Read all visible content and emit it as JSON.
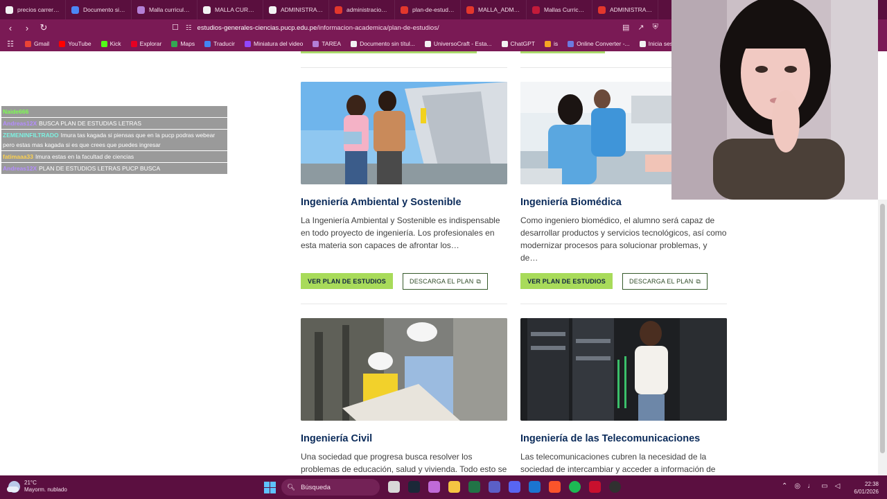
{
  "browser": {
    "tabs": [
      {
        "label": "precios carreras u",
        "color": "#f2f2f2"
      },
      {
        "label": "Documento sin tít",
        "color": "#4b86f5"
      },
      {
        "label": "Malla curricular E",
        "color": "#b37fd6"
      },
      {
        "label": "MALLA CURRICU",
        "color": "#f2f2f2"
      },
      {
        "label": "ADMINISTRACIÓ",
        "color": "#f2f2f2"
      },
      {
        "label": "administracion-d",
        "color": "#e3372c"
      },
      {
        "label": "plan-de-estudios",
        "color": "#e3372c"
      },
      {
        "label": "MALLA_ADMINI",
        "color": "#e3372c"
      },
      {
        "label": "Mallas Curricular",
        "color": "#c31b3a"
      },
      {
        "label": "ADMINISTRACIÓ",
        "color": "#e3372c"
      }
    ],
    "url_host": "estudios-generales-ciencias.pucp.edu.pe",
    "url_path": "/informacion-academica/plan-de-estudios/",
    "bookmarks": [
      {
        "label": "Gmail",
        "color": "#ea4335"
      },
      {
        "label": "YouTube",
        "color": "#ff0000"
      },
      {
        "label": "Kick",
        "color": "#53fc18"
      },
      {
        "label": "Explorar",
        "color": "#e60023"
      },
      {
        "label": "Maps",
        "color": "#34a853"
      },
      {
        "label": "Traducir",
        "color": "#4285f4"
      },
      {
        "label": "Miniatura del video",
        "color": "#9146ff"
      },
      {
        "label": "TAREA",
        "color": "#b37fd6"
      },
      {
        "label": "Documento sin títul...",
        "color": "#f2f2f2"
      },
      {
        "label": "UniversoCraft - Esta...",
        "color": "#f2f2f2"
      },
      {
        "label": "ChatGPT",
        "color": "#f2f2f2"
      },
      {
        "label": "is",
        "color": "#f5a623"
      },
      {
        "label": "Online Converter -...",
        "color": "#6c7ae0"
      },
      {
        "label": "Inicia sesión: Cuen",
        "color": "#f2f2f2"
      }
    ]
  },
  "cards": [
    {
      "title": "Ingeniería Ambiental y Sostenible",
      "description": "La Ingeniería Ambiental y Sostenible es indispensable en todo proyecto de ingeniería. Los profesionales en esta materia son capaces de afrontar los…",
      "plan_label": "VER PLAN DE ESTUDIOS",
      "download_label": "DESCARGA EL PLAN"
    },
    {
      "title": "Ingeniería Biomédica",
      "description": "Como ingeniero biomédico, el alumno será capaz de desarrollar productos y servicios tecnológicos, así como modernizar procesos para solucionar problemas, y de…",
      "plan_label": "VER PLAN DE ESTUDIOS",
      "download_label": "DESCARGA EL PLAN"
    },
    {
      "title": "Ingeniería Civil",
      "description": "Una sociedad que progresa busca resolver los problemas de educación, salud y vivienda. Todo esto se"
    },
    {
      "title": "Ingeniería de las Telecomunicaciones",
      "description": "Las telecomunicaciones cubren la necesidad de la sociedad de intercambiar y acceder a información de"
    }
  ],
  "chat": [
    {
      "user": "Naide666",
      "user_color": "#7cff4f",
      "message": ""
    },
    {
      "user": "Andreas12X",
      "user_color": "#b48cff",
      "message": "BUSCA PLAN DE ESTUDIAS LETRAS"
    },
    {
      "user": "ZEMENINFILTRADO",
      "user_color": "#7ef0e0",
      "message": "Imura tas kagada si piensas que en la pucp podras webear pero estas mas kagada si es que crees que puedes ingresar"
    },
    {
      "user": "fatimaaa33",
      "user_color": "#ffd34f",
      "message": "Imura estas en la facultad de ciencias"
    },
    {
      "user": "Andreas12X",
      "user_color": "#b48cff",
      "message": "PLAN DE ESTUDIOS LETRAS PUCP BUSCA"
    }
  ],
  "taskbar": {
    "temperature": "21°C",
    "condition": "Mayorm. nublado",
    "search_label": "Búsqueda",
    "time": "22:38",
    "date": "6/01/2026"
  }
}
